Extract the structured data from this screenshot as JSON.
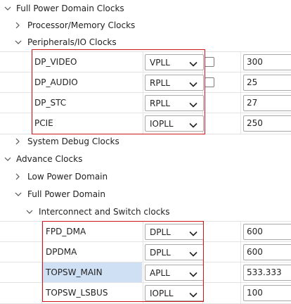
{
  "tree": {
    "full_power_domain_clocks": "Full Power Domain Clocks",
    "processor_memory_clocks": "Processor/Memory Clocks",
    "peripherals_io_clocks": "Peripherals/IO Clocks",
    "system_debug_clocks": "System Debug Clocks",
    "advance_clocks": "Advance Clocks",
    "low_power_domain": "Low Power Domain",
    "full_power_domain": "Full Power Domain",
    "interconnect_switch_clocks": "Interconnect and Switch clocks"
  },
  "peripherals": [
    {
      "name": "DP_VIDEO",
      "source": "VPLL",
      "has_checkbox": true,
      "value": "300"
    },
    {
      "name": "DP_AUDIO",
      "source": "RPLL",
      "has_checkbox": true,
      "value": "25"
    },
    {
      "name": "DP_STC",
      "source": "RPLL",
      "has_checkbox": false,
      "value": "27"
    },
    {
      "name": "PCIE",
      "source": "IOPLL",
      "has_checkbox": false,
      "value": "250"
    }
  ],
  "interconnect": [
    {
      "name": "FPD_DMA",
      "source": "DPLL",
      "value": "600",
      "selected": false
    },
    {
      "name": "DPDMA",
      "source": "DPLL",
      "value": "600",
      "selected": false
    },
    {
      "name": "TOPSW_MAIN",
      "source": "APLL",
      "value": "533.333",
      "selected": true
    },
    {
      "name": "TOPSW_LSBUS",
      "source": "IOPLL",
      "value": "100",
      "selected": false
    }
  ],
  "colors": {
    "highlight_box": "#d0181c",
    "selection": "#cfe0f5"
  }
}
